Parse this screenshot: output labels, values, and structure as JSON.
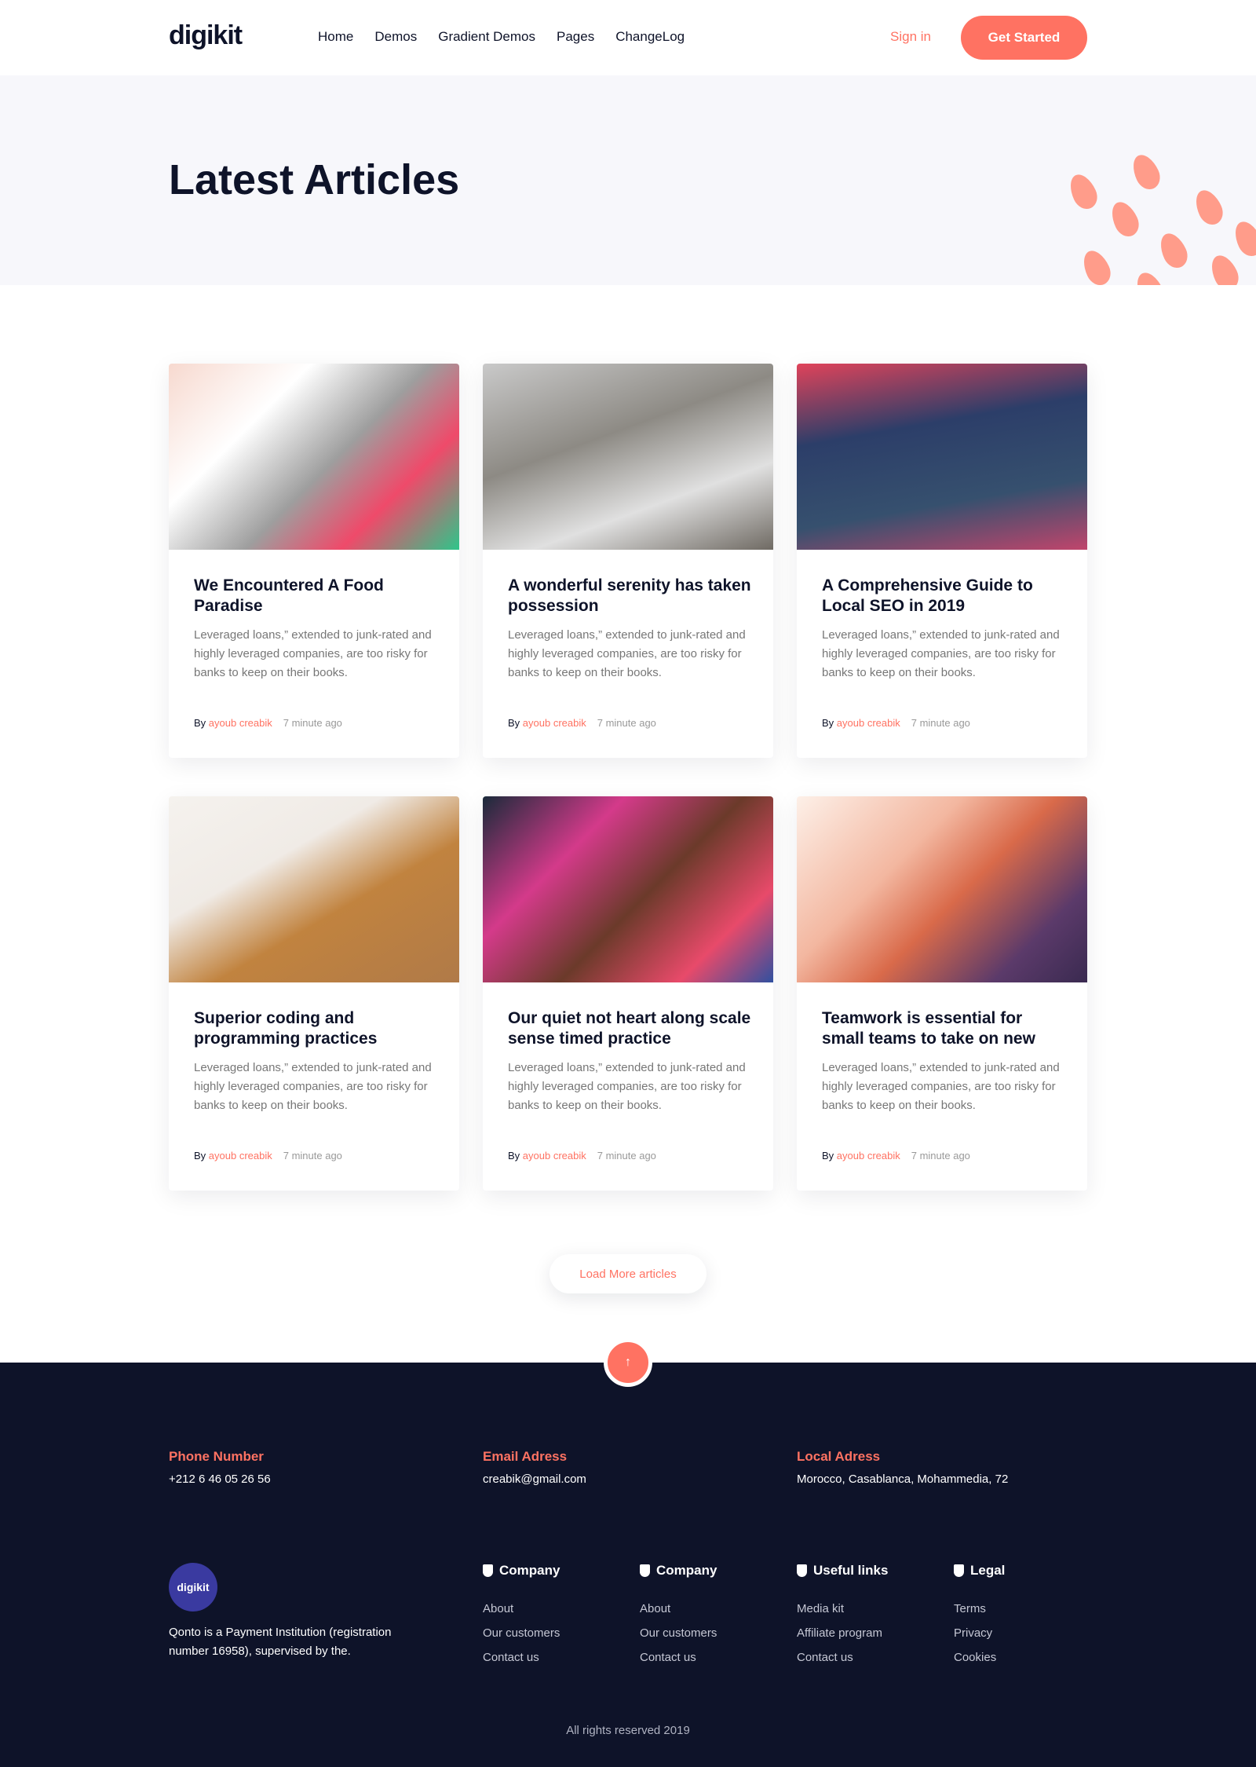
{
  "nav": {
    "logo": "digikit",
    "items": [
      "Home",
      "Demos",
      "Gradient Demos",
      "Pages",
      "ChangeLog"
    ],
    "sign_in": "Sign in",
    "get_started": "Get Started"
  },
  "hero": {
    "title": "Latest Articles"
  },
  "articles": [
    {
      "title": "We Encountered A Food Paradise",
      "excerpt": "Leveraged loans,” extended to junk-rated and highly leveraged companies, are too risky for banks to keep on their books.",
      "by": "By",
      "author": "ayoub creabik",
      "time": "7 minute ago"
    },
    {
      "title": "A wonderful serenity has taken possession",
      "excerpt": "Leveraged loans,” extended to junk-rated and highly leveraged companies, are too risky for banks to keep on their books.",
      "by": "By",
      "author": "ayoub creabik",
      "time": "7 minute ago"
    },
    {
      "title": "A Comprehensive Guide to Local SEO in 2019",
      "excerpt": "Leveraged loans,” extended to junk-rated and highly leveraged companies, are too risky for banks to keep on their books.",
      "by": "By",
      "author": "ayoub creabik",
      "time": "7 minute ago"
    },
    {
      "title": "Superior coding and programming practices",
      "excerpt": "Leveraged loans,” extended to junk-rated and highly leveraged companies, are too risky for banks to keep on their books.",
      "by": "By",
      "author": "ayoub creabik",
      "time": "7 minute ago"
    },
    {
      "title": "Our quiet not heart along scale sense timed practice",
      "excerpt": "Leveraged loans,” extended to junk-rated and highly leveraged companies, are too risky for banks to keep on their books.",
      "by": "By",
      "author": "ayoub creabik",
      "time": "7 minute ago"
    },
    {
      "title": "Teamwork is essential for small teams to take on new",
      "excerpt": "Leveraged loans,” extended to junk-rated and highly leveraged companies, are too risky for banks to keep on their books.",
      "by": "By",
      "author": "ayoub creabik",
      "time": "7 minute ago"
    }
  ],
  "load_more": "Load More articles",
  "footer": {
    "contacts": [
      {
        "label": "Phone Number",
        "value": "+212 6 46 05 26 56"
      },
      {
        "label": "Email Adress",
        "value": "creabik@gmail.com"
      },
      {
        "label": "Local Adress",
        "value": "Morocco, Casablanca, Mohammedia, 72"
      }
    ],
    "logo": "digikit",
    "description": "Qonto is a Payment Institution (registration number 16958), supervised by the.",
    "columns": [
      {
        "title": "Company",
        "links": [
          "About",
          "Our customers",
          "Contact us"
        ]
      },
      {
        "title": "Company",
        "links": [
          "About",
          "Our customers",
          "Contact us"
        ]
      },
      {
        "title": "Useful links",
        "links": [
          "Media kit",
          "Affiliate program",
          "Contact us"
        ]
      },
      {
        "title": "Legal",
        "links": [
          "Terms",
          "Privacy",
          "Cookies"
        ]
      }
    ],
    "copyright": "All rights reserved 2019"
  },
  "colors": {
    "accent": "#ff7262",
    "dark": "#0e1329",
    "hero_bg": "#f7f7fb"
  }
}
